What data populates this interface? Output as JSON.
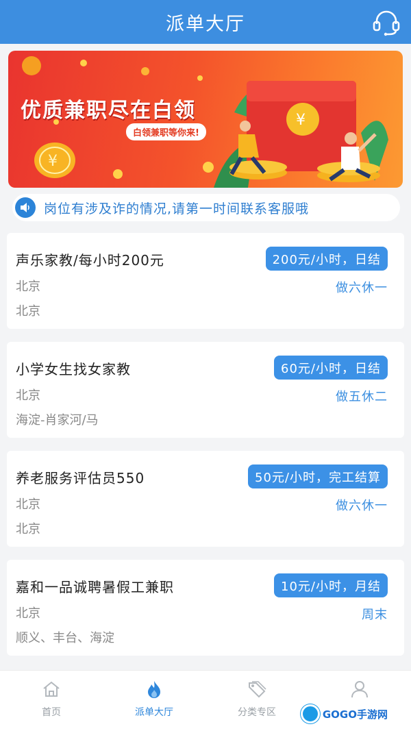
{
  "header": {
    "title": "派单大厅",
    "support_icon": "headset-icon"
  },
  "banner": {
    "headline": "优质兼职尽在白领",
    "subline": "白领兼职等你来!"
  },
  "notice": {
    "icon": "speaker-icon",
    "text": "岗位有涉及诈的情况,请第一时间联系客服哦"
  },
  "jobs": [
    {
      "title": "声乐家教/每小时200元",
      "pay": "200元/小时，日结",
      "city": "北京",
      "area": "北京",
      "schedule": "做六休一"
    },
    {
      "title": "小学女生找女家教",
      "pay": "60元/小时，日结",
      "city": "北京",
      "area": "海淀-肖家河/马",
      "schedule": "做五休二"
    },
    {
      "title": "养老服务评估员550",
      "pay": "50元/小时，完工结算",
      "city": "北京",
      "area": "北京",
      "schedule": "做六休一"
    },
    {
      "title": "嘉和一品诚聘暑假工兼职",
      "pay": "10元/小时，月结",
      "city": "北京",
      "area": "顺义、丰台、海淀",
      "schedule": "周末"
    }
  ],
  "tabbar": {
    "items": [
      {
        "label": "首页",
        "icon": "home-icon",
        "active": false
      },
      {
        "label": "派单大厅",
        "icon": "flame-icon",
        "active": true
      },
      {
        "label": "分类专区",
        "icon": "tag-icon",
        "active": false
      },
      {
        "label": "",
        "icon": "user-icon",
        "active": false
      }
    ]
  },
  "watermark": {
    "text": "GOGO手游网"
  },
  "colors": {
    "primary": "#3d8ee0",
    "banner_red": "#e9342f",
    "banner_orange": "#fc9a32",
    "text_muted": "#888888"
  }
}
